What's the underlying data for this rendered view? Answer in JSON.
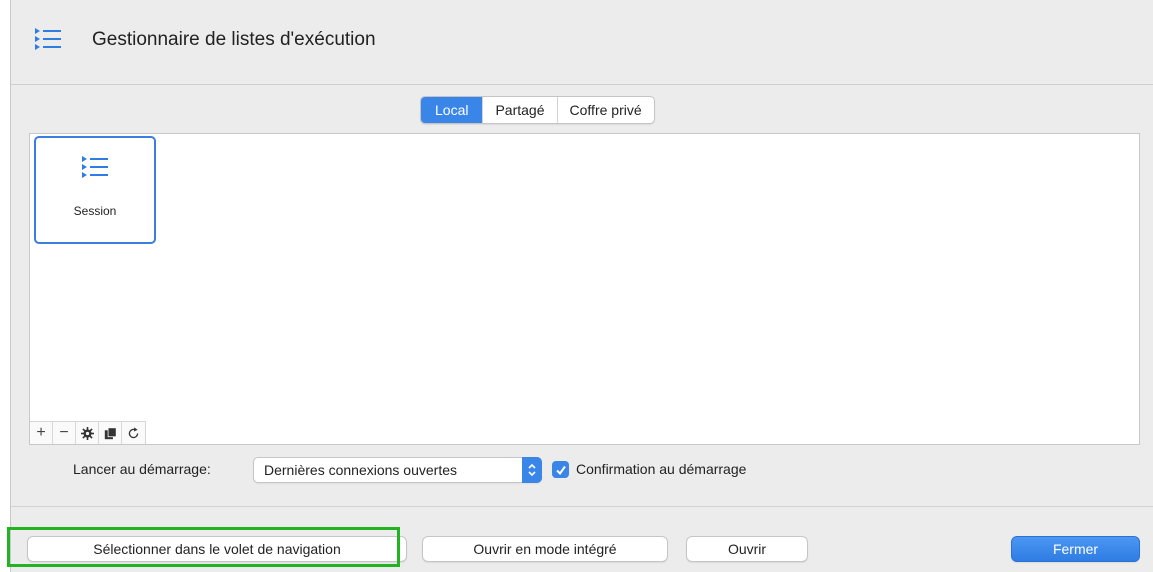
{
  "window": {
    "title": "Gestionnaire de listes d'exécution",
    "icon": "list-icon"
  },
  "tabs": [
    {
      "label": "Local",
      "active": true
    },
    {
      "label": "Partagé",
      "active": false
    },
    {
      "label": "Coffre privé",
      "active": false
    }
  ],
  "items": [
    {
      "label": "Session",
      "icon": "list-icon",
      "selected": true
    }
  ],
  "toolbar": {
    "add": "+",
    "remove": "−",
    "settings_icon": "gear-icon",
    "duplicate_icon": "duplicate-icon",
    "refresh_icon": "refresh-icon"
  },
  "launch": {
    "label": "Lancer au démarrage:",
    "selected_value": "Dernières connexions ouvertes",
    "confirm_checked": true,
    "confirm_label": "Confirmation au démarrage"
  },
  "buttons": {
    "select_in_nav": "Sélectionner dans le volet de navigation",
    "open_embedded": "Ouvrir en mode intégré",
    "open": "Ouvrir",
    "close": "Fermer"
  },
  "colors": {
    "accent": "#3a86e8",
    "highlight": "#21b321"
  }
}
